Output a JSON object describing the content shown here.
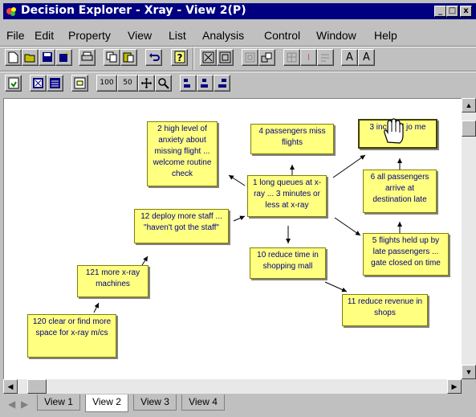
{
  "window": {
    "title": "Decision Explorer - Xray - View 2(P)",
    "controls": {
      "minimize": "_",
      "maximize": "□",
      "close": "x"
    }
  },
  "menu": [
    "File",
    "Edit",
    "Property",
    "View",
    "List",
    "Analysis",
    "Control",
    "Window",
    "Help"
  ],
  "toolbar1": {
    "zoom_in_label": "A",
    "zoom_out_label": "A",
    "cut_label": "I"
  },
  "toolbar2": {
    "zoom_100_label": "100",
    "zoom_50_label": "50"
  },
  "nodes": [
    {
      "id": "2",
      "text": "2 high level of anxiety about missing flight ... welcome routine check"
    },
    {
      "id": "4",
      "text": "4 passengers miss flights"
    },
    {
      "id": "3",
      "text": "3 inc     total jo       me"
    },
    {
      "id": "1",
      "text": "1 long queues at x-ray ... 3 minutes or less at x-ray"
    },
    {
      "id": "6",
      "text": "6 all passengers arrive at destination late"
    },
    {
      "id": "12",
      "text": "12 deploy more staff ... \"haven't got the staff\""
    },
    {
      "id": "5",
      "text": "5 flights held up by late passengers ... gate closed on time"
    },
    {
      "id": "10",
      "text": "10 reduce time in shopping mall"
    },
    {
      "id": "121",
      "text": "121 more x-ray machines"
    },
    {
      "id": "11",
      "text": "11 reduce revenue in shops"
    },
    {
      "id": "120",
      "text": "120 clear or find more space for x-ray m/cs"
    }
  ],
  "tabs": [
    "View 1",
    "View 2",
    "View 3",
    "View 4"
  ],
  "active_tab": "View 2",
  "colors": {
    "titlebar": "#000080",
    "node_fill": "#ffff80",
    "node_text": "#000080"
  }
}
